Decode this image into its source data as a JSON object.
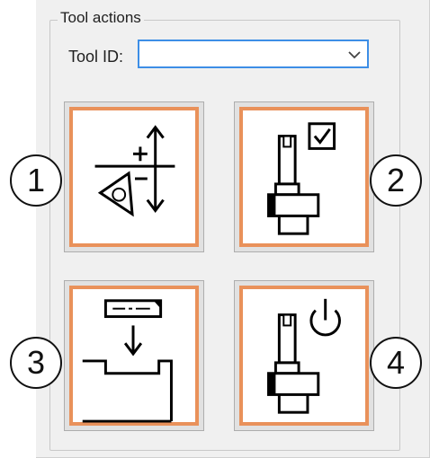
{
  "group": {
    "title": "Tool actions"
  },
  "tool_id": {
    "label": "Tool ID:",
    "value": ""
  },
  "actions": [
    {
      "callout": "1",
      "icon": "tool-offset-adjust-icon"
    },
    {
      "callout": "2",
      "icon": "tool-check-icon"
    },
    {
      "callout": "3",
      "icon": "tool-measure-icon"
    },
    {
      "callout": "4",
      "icon": "tool-power-icon"
    }
  ],
  "colors": {
    "accent": "#e9915a",
    "focus": "#3d8ee6",
    "panel": "#f0f0f0"
  }
}
